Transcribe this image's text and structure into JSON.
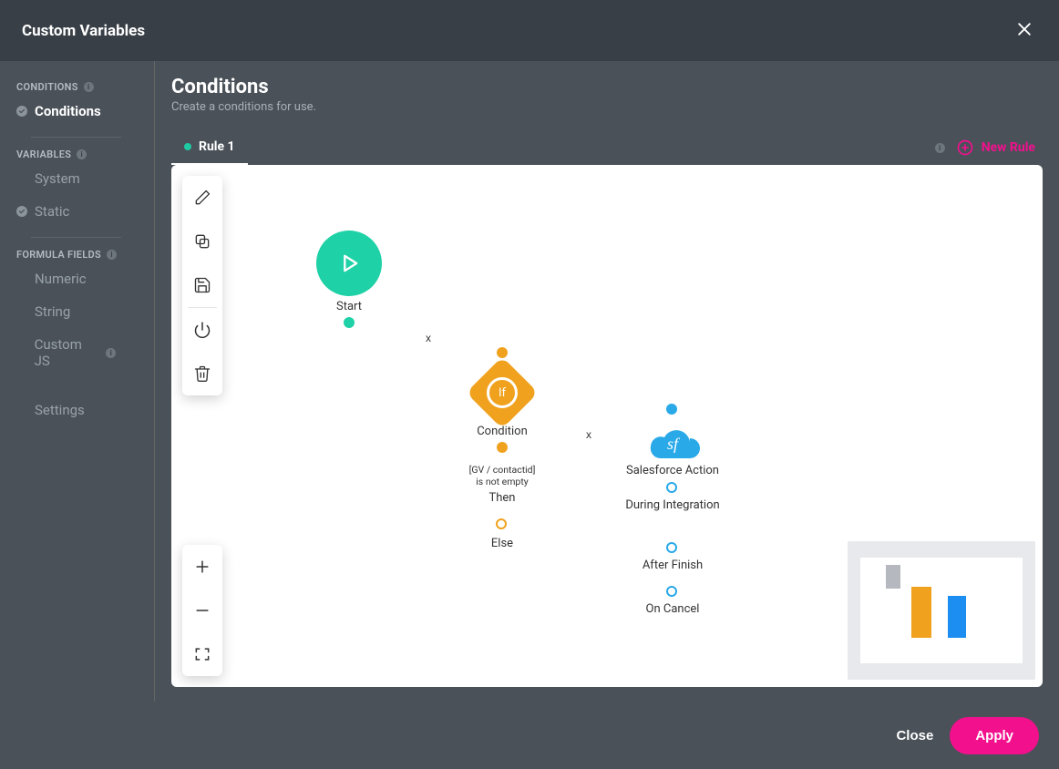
{
  "header": {
    "title": "Custom Variables"
  },
  "sidebar": {
    "sections": {
      "conditions": {
        "label": "CONDITIONS",
        "items": [
          {
            "label": "Conditions",
            "checked": true,
            "active": true
          }
        ]
      },
      "variables": {
        "label": "VARIABLES",
        "items": [
          {
            "label": "System"
          },
          {
            "label": "Static",
            "checked": true
          }
        ]
      },
      "formula": {
        "label": "FORMULA FIELDS",
        "items": [
          {
            "label": "Numeric"
          },
          {
            "label": "String"
          },
          {
            "label": "Custom JS",
            "info": true
          }
        ]
      }
    },
    "settings_label": "Settings"
  },
  "main": {
    "title": "Conditions",
    "subtitle": "Create a conditions for use."
  },
  "tabs": {
    "rule1_label": "Rule 1",
    "new_rule_label": "New Rule"
  },
  "nodes": {
    "start": {
      "label": "Start"
    },
    "condition": {
      "label": "Condition",
      "badge": "If",
      "desc1": "[GV / contactid]",
      "desc2": "is not empty",
      "then": "Then",
      "else": "Else"
    },
    "salesforce": {
      "label": "Salesforce Action",
      "badge": "sf",
      "p1": "During Integration",
      "p2": "After Finish",
      "p3": "On Cancel"
    }
  },
  "edges": {
    "x1": "x",
    "x2": "x"
  },
  "footer": {
    "close_label": "Close",
    "apply_label": "Apply"
  },
  "colors": {
    "accent_pink": "#f2108d",
    "accent_teal": "#1fd1a6",
    "accent_orange": "#f0a21e",
    "accent_blue": "#29a9e8"
  }
}
